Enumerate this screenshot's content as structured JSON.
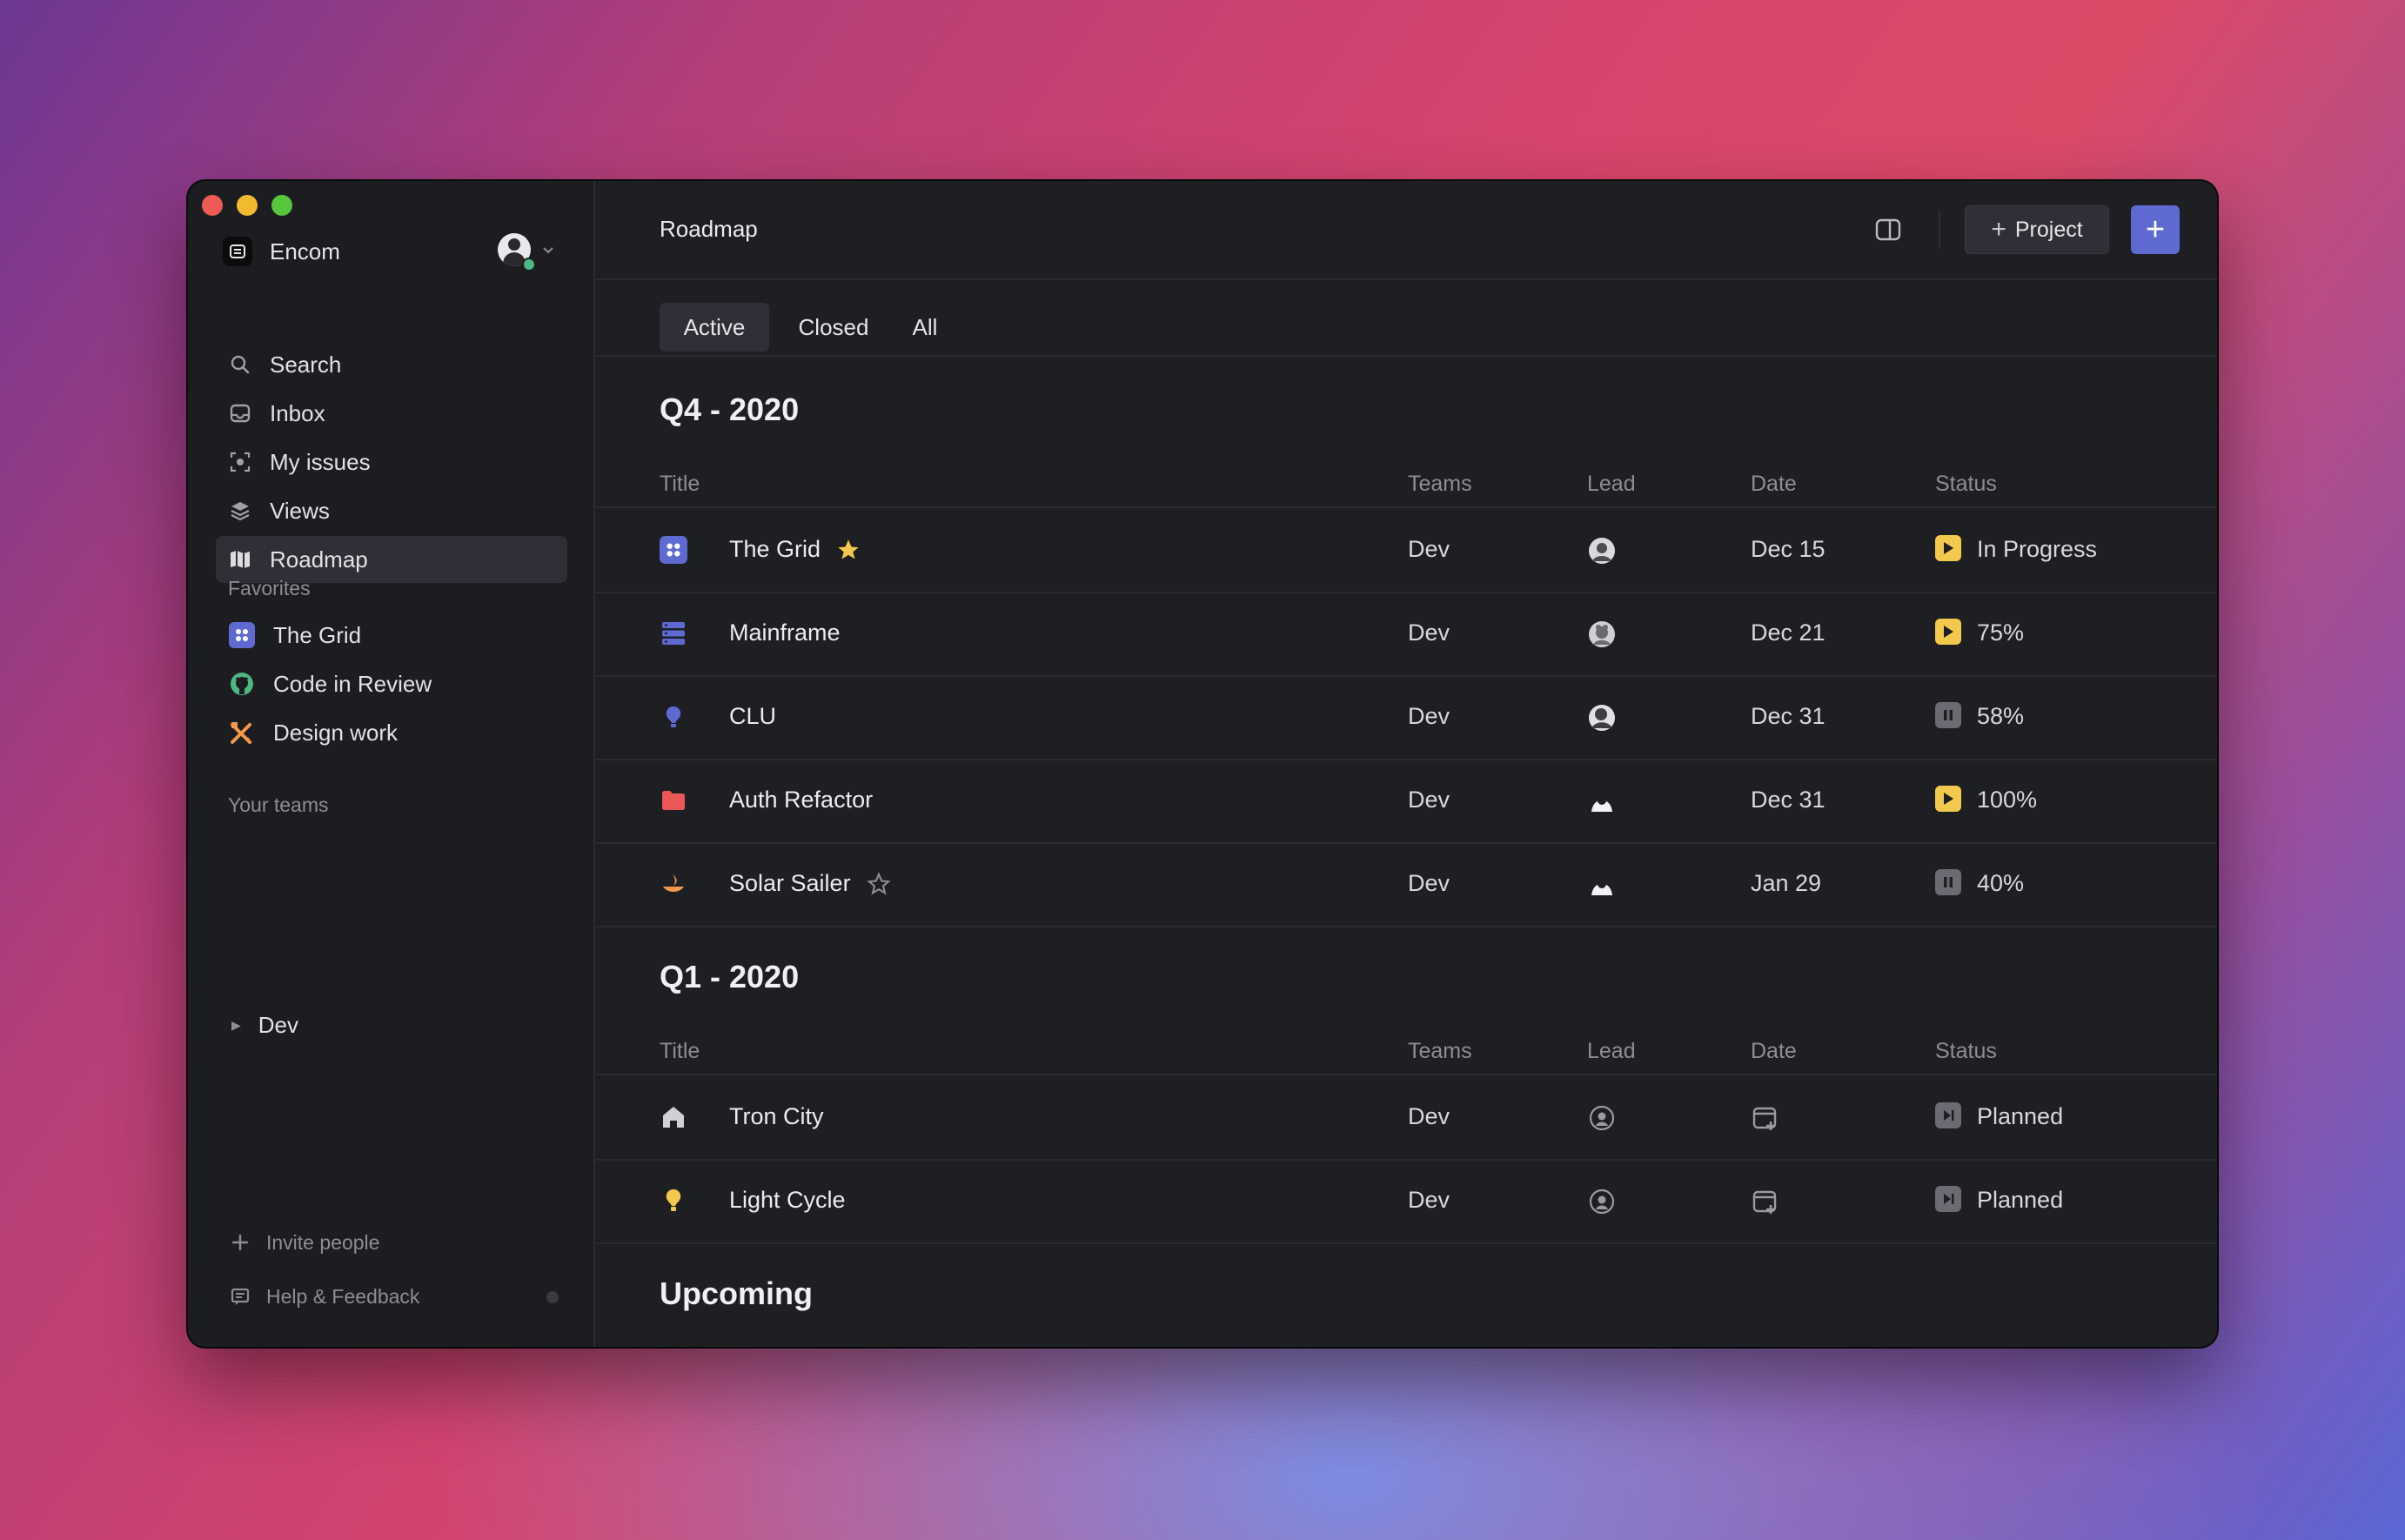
{
  "workspace": {
    "name": "Encom"
  },
  "nav": [
    {
      "label": "Search",
      "icon": "search-icon"
    },
    {
      "label": "Inbox",
      "icon": "inbox-icon"
    },
    {
      "label": "My issues",
      "icon": "my-issues-icon"
    },
    {
      "label": "Views",
      "icon": "views-icon"
    },
    {
      "label": "Roadmap",
      "icon": "roadmap-icon",
      "active": true
    }
  ],
  "favorites": {
    "heading": "Favorites",
    "items": [
      {
        "label": "The Grid",
        "icon": "grid-project-icon",
        "color": "#5e6ad2"
      },
      {
        "label": "Code in Review",
        "icon": "github-icon",
        "color": "#4cb782"
      },
      {
        "label": "Design work",
        "icon": "design-tools-icon",
        "color": "#f2994a"
      }
    ]
  },
  "teams": {
    "heading": "Your teams",
    "items": [
      {
        "label": "Dev"
      }
    ]
  },
  "footer": {
    "invite": "Invite people",
    "help": "Help & Feedback"
  },
  "header": {
    "title": "Roadmap",
    "project_button": "Project",
    "accent": "#5e6ad2"
  },
  "tabs": [
    {
      "label": "Active",
      "active": true
    },
    {
      "label": "Closed"
    },
    {
      "label": "All"
    }
  ],
  "columns": {
    "title": "Title",
    "teams": "Teams",
    "lead": "Lead",
    "date": "Date",
    "status": "Status"
  },
  "groups": [
    {
      "name": "Q4 - 2020",
      "projects": [
        {
          "title": "The Grid",
          "team": "Dev",
          "date": "Dec 15",
          "status": "In Progress",
          "starred": true,
          "icon": "grid-project-icon"
        },
        {
          "title": "Mainframe",
          "team": "Dev",
          "date": "Dec 21",
          "status": "75%",
          "progress": 0.75,
          "icon": "server-icon"
        },
        {
          "title": "CLU",
          "team": "Dev",
          "date": "Dec 31",
          "status": "58%",
          "progress": 0.58,
          "paused": true,
          "icon": "bulb-icon"
        },
        {
          "title": "Auth Refactor",
          "team": "Dev",
          "date": "Dec 31",
          "status": "100%",
          "progress": 1.0,
          "icon": "folder-icon"
        },
        {
          "title": "Solar Sailer",
          "team": "Dev",
          "date": "Jan 29",
          "status": "40%",
          "progress": 0.4,
          "paused": true,
          "starred": false,
          "icon": "sailer-icon"
        }
      ]
    },
    {
      "name": "Q1 - 2020",
      "projects": [
        {
          "title": "Tron City",
          "team": "Dev",
          "status": "Planned",
          "icon": "home-icon"
        },
        {
          "title": "Light Cycle",
          "team": "Dev",
          "status": "Planned",
          "icon": "lightbulb-icon"
        }
      ]
    },
    {
      "name": "Upcoming",
      "projects": []
    }
  ]
}
